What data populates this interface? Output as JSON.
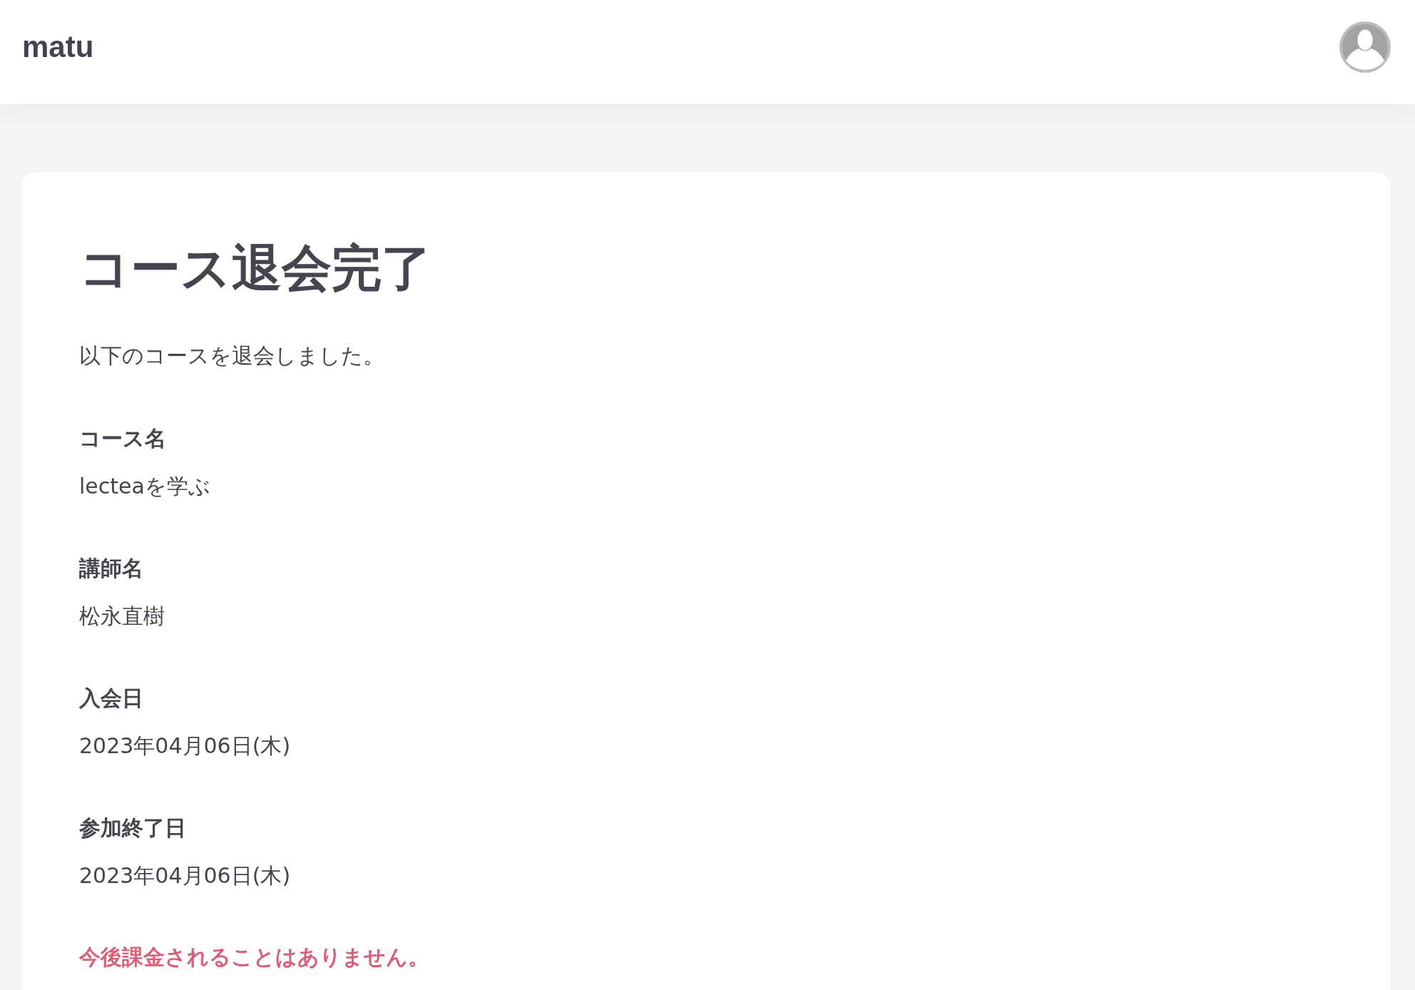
{
  "header": {
    "site_name": "matu"
  },
  "page": {
    "title": "コース退会完了",
    "message": "以下のコースを退会しました。",
    "details": [
      {
        "label": "コース名",
        "value": "lecteaを学ぶ"
      },
      {
        "label": "講師名",
        "value": "松永直樹"
      },
      {
        "label": "入会日",
        "value": "2023年04月06日(木)"
      },
      {
        "label": "参加終了日",
        "value": "2023年04月06日(木)"
      }
    ],
    "notice": "今後課金されることはありません。"
  }
}
